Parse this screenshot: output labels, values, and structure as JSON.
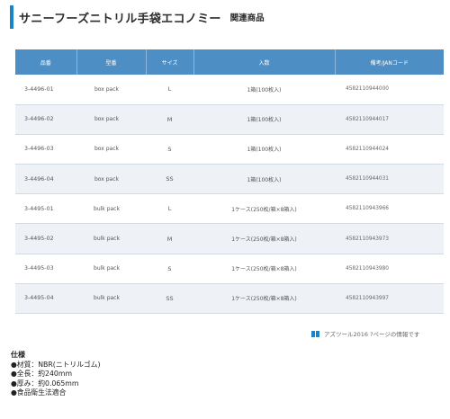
{
  "header": {
    "title": "サニーフーズニトリル手袋エコノミー",
    "related": "関連商品"
  },
  "colors": {
    "accent": "#1a84c7",
    "header_bg": "#4d8fc4",
    "row_alt": "#eef2f7"
  },
  "table": {
    "columns": [
      "品番",
      "型番",
      "サイズ",
      "入数",
      "備考/JANコード"
    ],
    "rows": [
      {
        "code": "3-4496-01",
        "type": "box pack",
        "size": "L",
        "qty": "1箱(100枚入)",
        "jan": "4582110944000"
      },
      {
        "code": "3-4496-02",
        "type": "box pack",
        "size": "M",
        "qty": "1箱(100枚入)",
        "jan": "4582110944017"
      },
      {
        "code": "3-4496-03",
        "type": "box pack",
        "size": "S",
        "qty": "1箱(100枚入)",
        "jan": "4582110944024"
      },
      {
        "code": "3-4496-04",
        "type": "box pack",
        "size": "SS",
        "qty": "1箱(100枚入)",
        "jan": "4582110944031"
      },
      {
        "code": "3-4495-01",
        "type": "bulk pack",
        "size": "L",
        "qty": "1ケース(250枚/箱×8箱入)",
        "jan": "4582110943966"
      },
      {
        "code": "3-4495-02",
        "type": "bulk pack",
        "size": "M",
        "qty": "1ケース(250枚/箱×8箱入)",
        "jan": "4582110943973"
      },
      {
        "code": "3-4495-03",
        "type": "bulk pack",
        "size": "S",
        "qty": "1ケース(250枚/箱×8箱入)",
        "jan": "4582110943980"
      },
      {
        "code": "3-4495-04",
        "type": "bulk pack",
        "size": "SS",
        "qty": "1ケース(250枚/箱×8箱入)",
        "jan": "4582110943997"
      }
    ]
  },
  "source_note": {
    "icon": "book-icon",
    "text": "アズツール2016 ?ページの情報です"
  },
  "specs": {
    "title": "仕様",
    "items": [
      "●材質：NBR(ニトリルゴム)",
      "●全長：約240mm",
      "●厚み：約0.065mm",
      "●食品衛生法適合"
    ]
  }
}
